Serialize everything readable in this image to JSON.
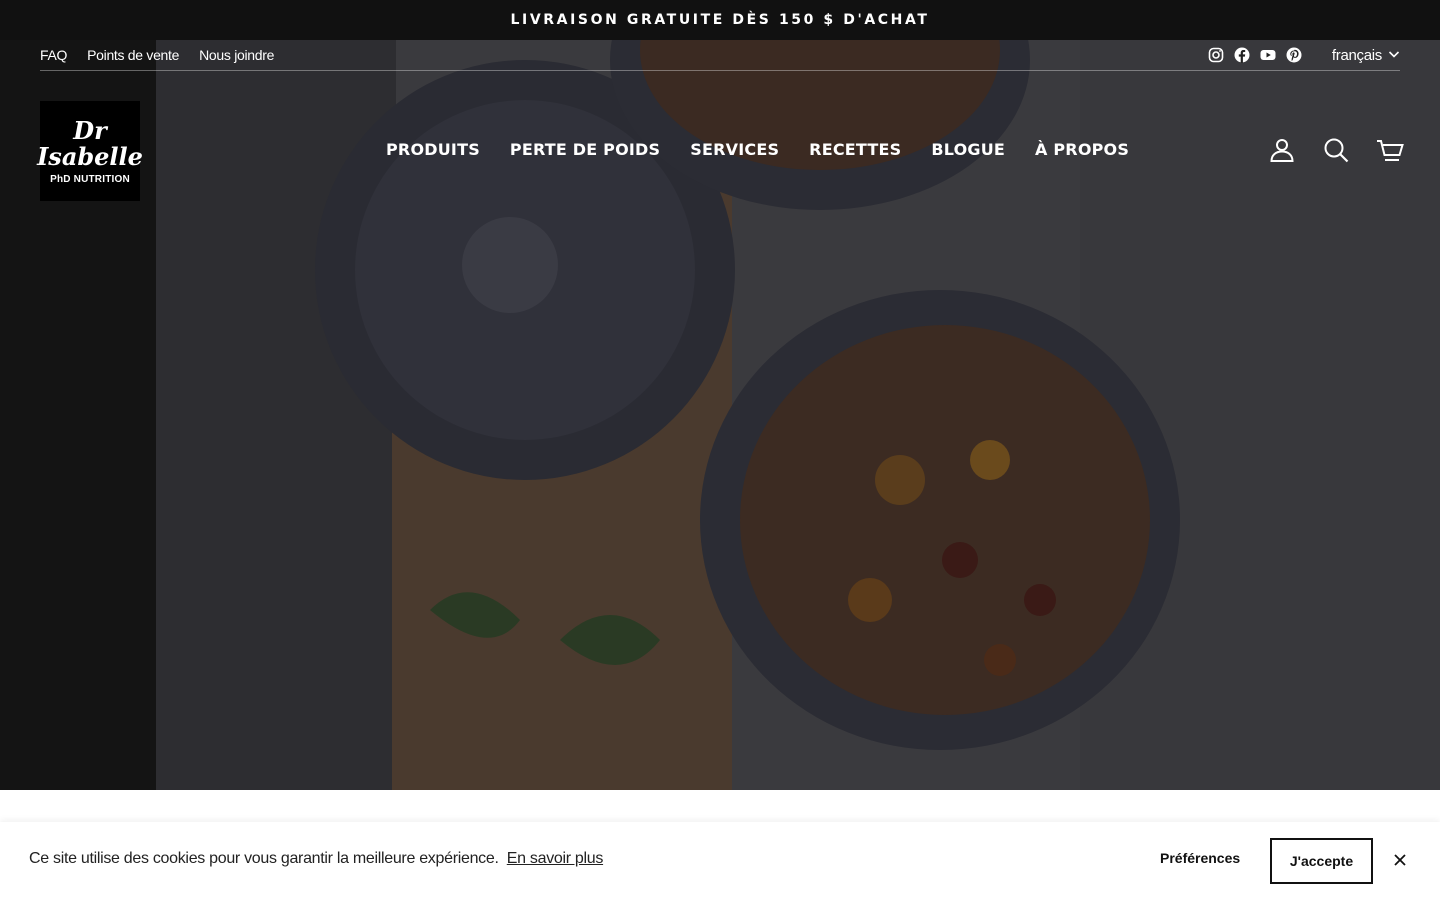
{
  "announcement": "LIVRAISON GRATUITE DÈS 150 $ D'ACHAT",
  "utility": {
    "links": [
      "FAQ",
      "Points de vente",
      "Nous joindre"
    ],
    "social_icons": [
      "instagram-icon",
      "facebook-icon",
      "youtube-icon",
      "pinterest-icon"
    ],
    "language": "français"
  },
  "logo": {
    "line1": "Dr",
    "line2": "Isabelle",
    "line3": "PhD NUTRITION"
  },
  "nav": [
    "PRODUITS",
    "PERTE DE POIDS",
    "SERVICES",
    "RECETTES",
    "BLOGUE",
    "À PROPOS"
  ],
  "header_icons": [
    "account-icon",
    "search-icon",
    "cart-icon"
  ],
  "cookie": {
    "message": "Ce site utilise des cookies pour vous garantir la meilleure expérience.",
    "learn_more": "En savoir plus",
    "preferences": "Préférences",
    "accept": "J'accepte"
  },
  "colors": {
    "announcement_bg": "#111111",
    "hero_overlay": "#000000",
    "cookie_bg": "#ffffff",
    "text_dark": "#111111"
  }
}
